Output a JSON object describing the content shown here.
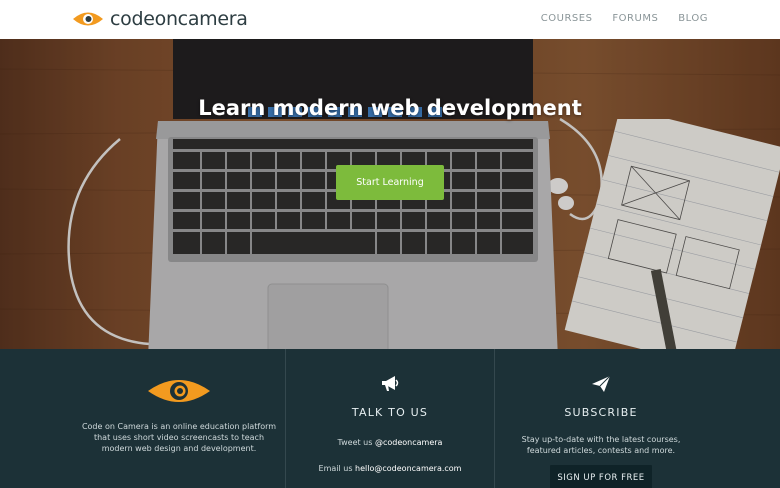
{
  "brand": {
    "name": "codeoncamera",
    "accent": "#f29a1f"
  },
  "nav": {
    "items": [
      "COURSES",
      "FORUMS",
      "BLOG"
    ]
  },
  "hero": {
    "title": "Learn modern web development",
    "cta_label": "Start Learning",
    "cta_color": "#7dbb3c"
  },
  "footer": {
    "about": "Code on Camera is an online education platform that uses short video screencasts to teach modern web design and development.",
    "talk": {
      "icon": "megaphone-icon",
      "heading": "TALK TO US",
      "tweet_prefix": "Tweet us",
      "twitter": "@codeoncamera",
      "email_prefix": "Email us",
      "email": "hello@codeoncamera.com"
    },
    "subscribe": {
      "icon": "paper-plane-icon",
      "heading": "SUBSCRIBE",
      "text": "Stay up-to-date with the latest courses, featured articles, contests and more.",
      "button_label": "SIGN UP FOR FREE"
    },
    "background": "#1c3137"
  }
}
